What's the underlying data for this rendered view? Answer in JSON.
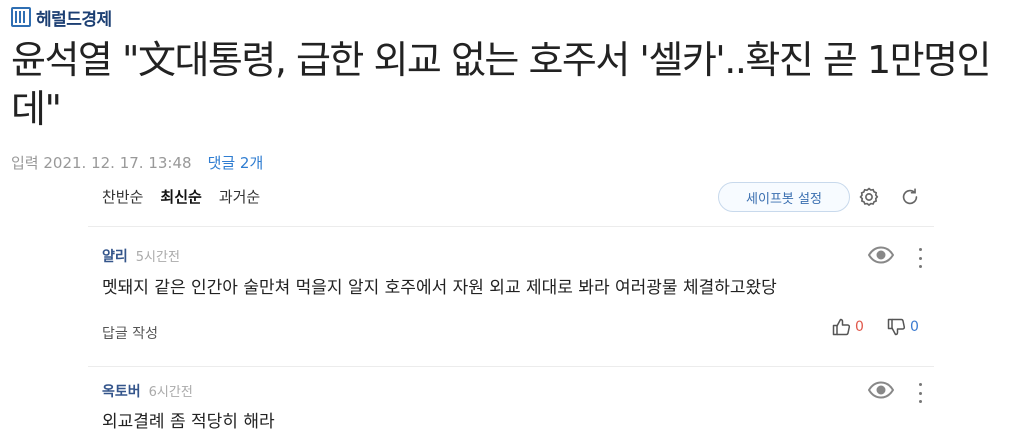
{
  "press": {
    "name": "헤럴드경제",
    "icon": "herald-logo-icon"
  },
  "article": {
    "headline": "윤석열 \"文대통령, 급한 외교 없는 호주서 '셀카'..확진 곧 1만명인데\"",
    "published_label": "입력 2021. 12. 17. 13:48",
    "comment_link": "댓글 2개"
  },
  "toolbar": {
    "sorts": [
      "찬반순",
      "최신순",
      "과거순"
    ],
    "active_sort": "최신순",
    "safebot_label": "세이프봇 설정",
    "settings_icon": "gear-icon",
    "refresh_icon": "refresh-icon"
  },
  "comments": [
    {
      "user": "얄리",
      "time": "5시간전",
      "text": "멧돼지 같은  인간아 술만쳐 먹을지 알지 호주에서 자원 외교 제대로 봐라 여러광물 체결하고왔당",
      "reply_label": "답글 작성",
      "likes": "0",
      "dislikes": "0"
    },
    {
      "user": "옥토버",
      "time": "6시간전",
      "text": "외교결례 좀 적당히 해라"
    }
  ],
  "colors": {
    "link": "#2f7dd1",
    "brand": "#1c3f73",
    "like": "#e0584b",
    "dislike": "#3a7ad0"
  }
}
